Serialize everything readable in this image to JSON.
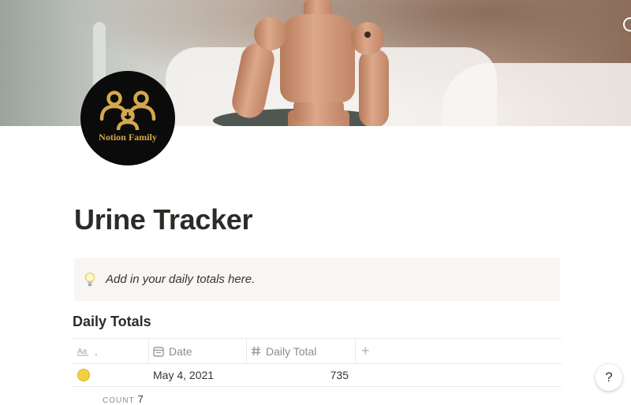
{
  "page": {
    "icon_brand": "Notion Family",
    "title": "Urine Tracker",
    "callout_text": "Add in your daily totals here.",
    "callout_icon": "lightbulb-icon"
  },
  "database": {
    "heading": "Daily Totals",
    "columns": [
      {
        "label": ".",
        "icon": "text-aa-icon"
      },
      {
        "label": "Date",
        "icon": "calendar-icon"
      },
      {
        "label": "Daily Total",
        "icon": "hash-icon"
      }
    ],
    "add_column_label": "+",
    "rows": [
      {
        "name_icon": "yellow-circle-icon",
        "date": "May 4, 2021",
        "daily_total": "735"
      }
    ],
    "footer": {
      "count_label": "COUNT",
      "count_value": "7"
    }
  },
  "help_button": {
    "label": "?"
  },
  "colors": {
    "icon_bg": "#0b0b0b",
    "brand_gold": "#d4a84a",
    "callout_bg": "#f7f6f2"
  }
}
